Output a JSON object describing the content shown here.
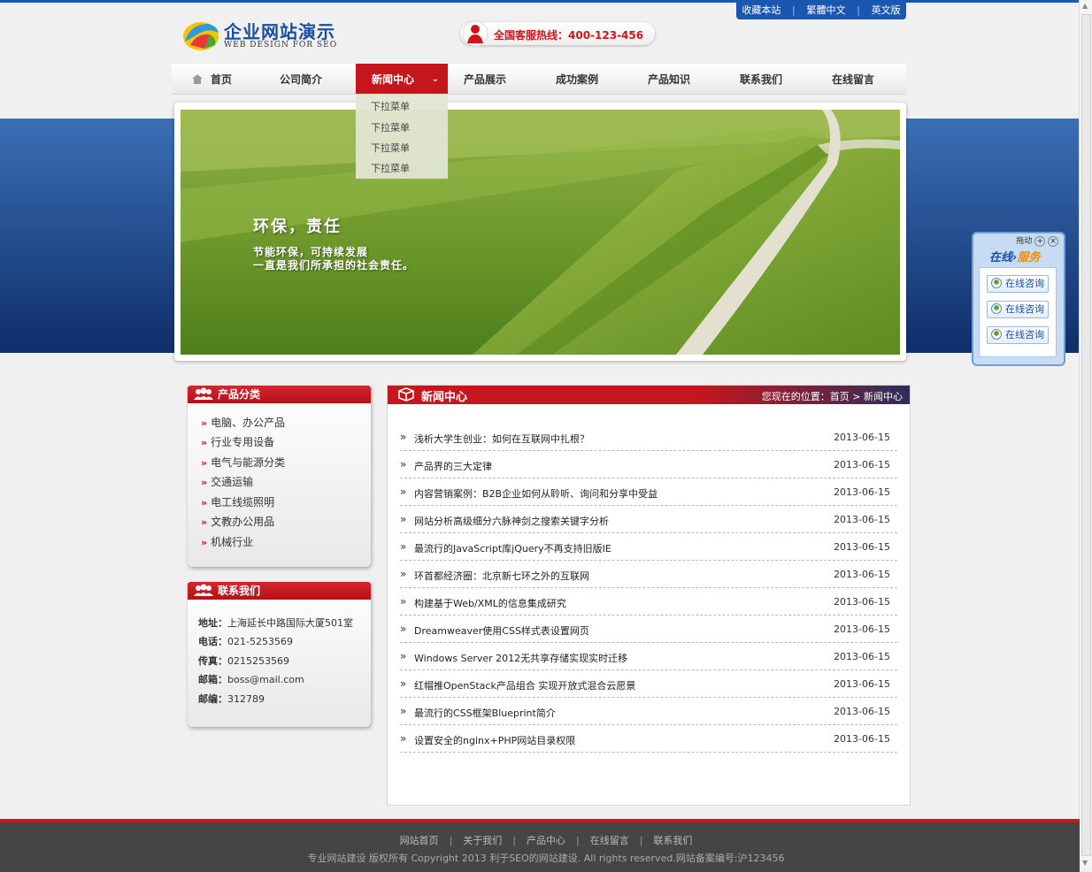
{
  "toplinks": [
    "收藏本站",
    "繁體中文",
    "英文版"
  ],
  "logo": {
    "title": "企业网站演示",
    "subtitle": "WEB DESIGN FOR SEO"
  },
  "hotline": {
    "label": "全国客服热线：400-123-456"
  },
  "nav": {
    "items": [
      "首页",
      "公司简介",
      "新闻中心",
      "产品展示",
      "成功案例",
      "产品知识",
      "联系我们",
      "在线留言"
    ],
    "active_index": 2,
    "dropdown": [
      "下拉菜单",
      "下拉菜单",
      "下拉菜单",
      "下拉菜单"
    ]
  },
  "banner": {
    "headline": "环保，责任",
    "line1": "节能环保，可持续发展",
    "line2": "一直是我们所承担的社会责任。"
  },
  "service": {
    "drag": "拖动",
    "title_a": "在线",
    "title_b": "服务",
    "buttons": [
      "在线咨询",
      "在线咨询",
      "在线咨询"
    ]
  },
  "categories": {
    "title": "产品分类",
    "items": [
      "电脑、办公产品",
      "行业专用设备",
      "电气与能源分类",
      "交通运输",
      "电工线缆照明",
      "文教办公用品",
      "机械行业"
    ]
  },
  "contact": {
    "title": "联系我们",
    "rows": [
      {
        "label": "地址：",
        "value": "上海延长中路国际大厦501室"
      },
      {
        "label": "电话：",
        "value": "021-5253569"
      },
      {
        "label": "传真：",
        "value": "0215253569"
      },
      {
        "label": "邮箱：",
        "value": "boss@mail.com"
      },
      {
        "label": "邮编：",
        "value": "312789"
      }
    ]
  },
  "news": {
    "title": "新闻中心",
    "breadcrumb": "您现在的位置：首页 > 新闻中心",
    "items": [
      {
        "title": "浅析大学生创业：如何在互联网中扎根？",
        "date": "2013-06-15"
      },
      {
        "title": "产品界的三大定律",
        "date": "2013-06-15"
      },
      {
        "title": "内容营销案例：B2B企业如何从聆听、询问和分享中受益",
        "date": "2013-06-15"
      },
      {
        "title": "网站分析高级细分六脉神剑之搜索关键字分析",
        "date": "2013-06-15"
      },
      {
        "title": "最流行的JavaScript库jQuery不再支持旧版IE",
        "date": "2013-06-15"
      },
      {
        "title": "环首都经济圈：北京新七环之外的互联网",
        "date": "2013-06-15"
      },
      {
        "title": "构建基于Web/XML的信息集成研究",
        "date": "2013-06-15"
      },
      {
        "title": "Dreamweaver使用CSS样式表设置网页",
        "date": "2013-06-15"
      },
      {
        "title": "Windows Server 2012无共享存储实现实时迁移",
        "date": "2013-06-15"
      },
      {
        "title": "红帽推OpenStack产品组合 实现开放式混合云愿景",
        "date": "2013-06-15"
      },
      {
        "title": "最流行的CSS框架Blueprint简介",
        "date": "2013-06-15"
      },
      {
        "title": "设置安全的nginx+PHP网站目录权限",
        "date": "2013-06-15"
      }
    ]
  },
  "footer": {
    "links": [
      "网站首页",
      "关于我们",
      "产品中心",
      "在线留言",
      "联系我们"
    ],
    "copyright": "专业网站建设 版权所有 Copyright 2013 利于SEO的网站建设. All rights reserved.网站备案编号:沪123456"
  },
  "colors": {
    "brand_red": "#c4161c",
    "brand_blue": "#1a57b0",
    "footer_bg": "#454545"
  }
}
